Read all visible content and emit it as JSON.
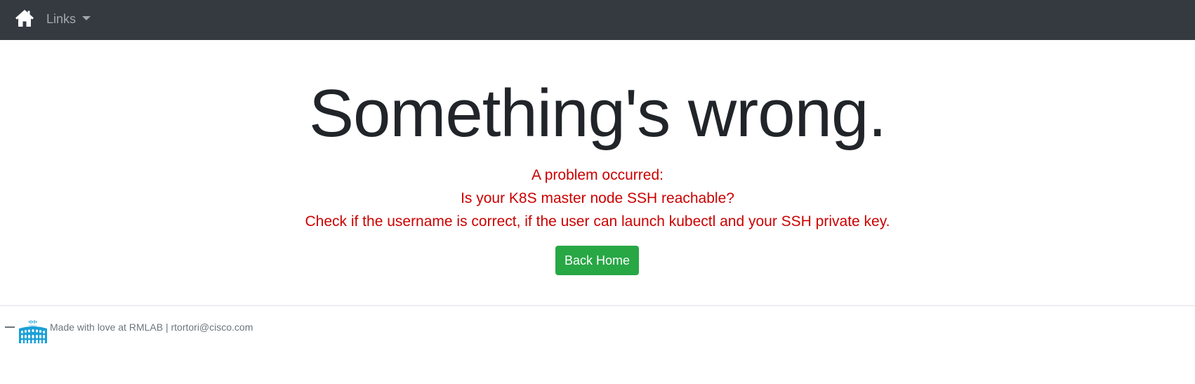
{
  "navbar": {
    "home_icon": "home-icon",
    "links_label": "Links",
    "links_caret_icon": "caret-down-icon"
  },
  "main": {
    "headline": "Something's wrong.",
    "messages": [
      "A problem occurred:",
      "Is your K8S master node SSH reachable?",
      "Check if the username is correct, if the user can launch kubectl and your SSH private key."
    ],
    "back_button_label": "Back Home"
  },
  "footer": {
    "dash": "—",
    "logo_icon": "colosseum-cisco-logo",
    "logo_brand_text": "cisco",
    "text": "Made with love at RMLAB | rtortori@cisco.com"
  },
  "colors": {
    "navbar_bg": "#343a40",
    "error_text": "#cc0000",
    "button_bg": "#28a745",
    "footer_text": "#6c757d",
    "logo_blue": "#1ba0d7"
  }
}
